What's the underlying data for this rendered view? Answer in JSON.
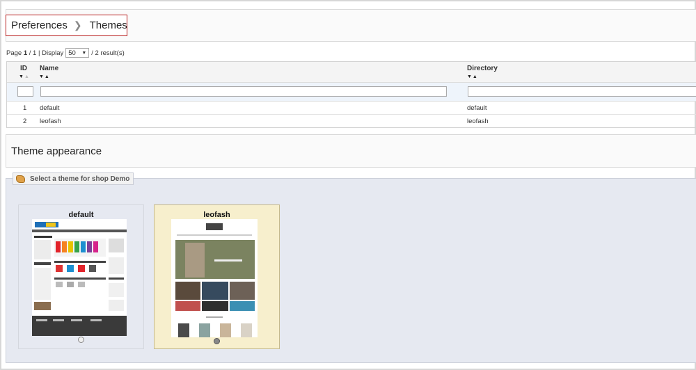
{
  "breadcrumb": {
    "parent": "Preferences",
    "current": "Themes"
  },
  "pager": {
    "page_label": "Page",
    "page_current": "1",
    "page_sep": "/",
    "page_total": "1",
    "display_label": "| Display",
    "display_value": "50",
    "results_text": "/ 2 result(s)"
  },
  "grid": {
    "columns": [
      {
        "key": "id",
        "label": "ID"
      },
      {
        "key": "name",
        "label": "Name"
      },
      {
        "key": "directory",
        "label": "Directory"
      }
    ],
    "rows": [
      {
        "id": "1",
        "name": "default",
        "directory": "default"
      },
      {
        "id": "2",
        "name": "leofash",
        "directory": "leofash"
      }
    ]
  },
  "appearance": {
    "title": "Theme appearance",
    "legend": "Select a theme for shop Demo",
    "themes": [
      {
        "name": "default",
        "selected": false
      },
      {
        "name": "leofash",
        "selected": true
      }
    ]
  },
  "colors": {
    "breadcrumb_border": "#b71c1c",
    "fieldset_bg": "#e6e9f1",
    "selected_card_bg": "#f7efcd",
    "filter_row_bg": "#eef4fb"
  },
  "icons": {
    "separator": "chevron-right-icon",
    "legend": "theme-palette-icon",
    "sort": "sort-desc-asc-icon"
  }
}
